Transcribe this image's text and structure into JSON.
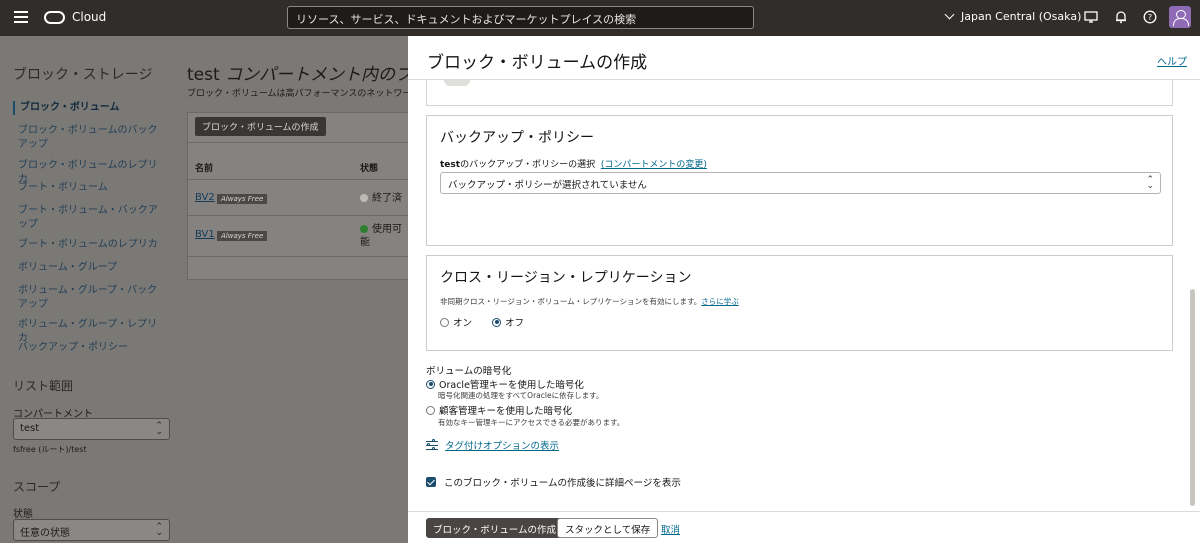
{
  "topbar": {
    "brand": "Cloud",
    "search_placeholder": "リソース、サービス、ドキュメントおよびマーケットプレイスの検索",
    "region": "Japan Central (Osaka)"
  },
  "sidebar": {
    "title": "ブロック・ストレージ",
    "items": [
      {
        "label": "ブロック・ボリューム"
      },
      {
        "label": "ブロック・ボリュームのバックアップ"
      },
      {
        "label": "ブロック・ボリュームのレプリカ"
      },
      {
        "label": "ブート・ボリューム"
      },
      {
        "label": "ブート・ボリューム・バックアップ"
      },
      {
        "label": "ブート・ボリュームのレプリカ"
      },
      {
        "label": "ボリューム・グループ"
      },
      {
        "label": "ボリューム・グループ・バックアップ"
      },
      {
        "label": "ボリューム・グループ・レプリカ"
      },
      {
        "label": "バックアップ・ポリシー"
      }
    ],
    "list_scope": {
      "title": "リスト範囲",
      "compartment_label": "コンパートメント",
      "compartment_value": "test",
      "compartment_path": "fsfree (ルート)/test"
    },
    "scope": {
      "title": "スコープ",
      "state_label": "状態",
      "state_value": "任意の状態"
    }
  },
  "main": {
    "title_prefix": "test",
    "title_rest": " コンパートメント内のブ",
    "description": "ブロック・ボリュームは高パフォーマンスのネットワーク",
    "create_button": "ブロック・ボリュームの作成",
    "columns": [
      "名前",
      "状態"
    ],
    "rows": [
      {
        "name": "BV2",
        "tag": "Always Free",
        "state": "終了済",
        "state_color": "#bdbab6"
      },
      {
        "name": "BV1",
        "tag": "Always Free",
        "state": "使用可能",
        "state_line1": "使用可",
        "state_line2": "能",
        "state_color": "#2c7f2d"
      }
    ]
  },
  "drawer": {
    "title": "ブロック・ボリュームの作成",
    "help": "ヘルプ",
    "backup_policy": {
      "title": "バックアップ・ポリシー",
      "label_bold": "test",
      "label_rest": "のバックアップ・ポリシーの選択",
      "change_link": "(コンパートメントの変更)",
      "select_value": "バックアップ・ポリシーが選択されていません"
    },
    "cross_region": {
      "title": "クロス・リージョン・レプリケーション",
      "description": "非同期クロス・リージョン・ボリューム・レプリケーションを有効にします。",
      "learn_more": "さらに学ぶ",
      "option_on": "オン",
      "option_off": "オフ",
      "selected": "off"
    },
    "encryption": {
      "title": "ボリュームの暗号化",
      "option1": "Oracle管理キーを使用した暗号化",
      "option1_desc": "暗号化関連の処理をすべてOracleに依存します。",
      "option2": "顧客管理キーを使用した暗号化",
      "option2_desc": "有効なキー管理キーにアクセスできる必要があります。"
    },
    "tag_options": "タグ付けオプションの表示",
    "show_details_checkbox": "このブロック・ボリュームの作成後に詳細ページを表示",
    "footer": {
      "create": "ブロック・ボリュームの作成",
      "save_stack": "スタックとして保存",
      "cancel": "取消"
    }
  }
}
